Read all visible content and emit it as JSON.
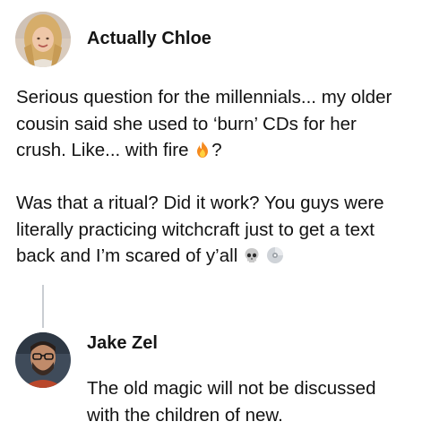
{
  "post": {
    "author": "Actually Chloe",
    "paragraph1": {
      "line1": "Serious question for the millennials... my older",
      "line2": "cousin said she used to ‘burn’ CDs for her",
      "line3_text": "crush. Like... with fire",
      "line3_after_emoji": "?"
    },
    "paragraph2": {
      "line1": "Was that a ritual? Did it work? You guys were",
      "line2": "literally practicing witchcraft just to get a text",
      "line3_text": "back and I’m scared of y’all"
    },
    "emojis": [
      "fire-icon",
      "skull-icon",
      "cd-icon"
    ]
  },
  "reply": {
    "author": "Jake Zel",
    "line1": "The old magic will not be discussed",
    "line2": "with the children of new."
  },
  "colors": {
    "text": "#121212",
    "connector": "#c9cdd2",
    "background": "#ffffff"
  }
}
